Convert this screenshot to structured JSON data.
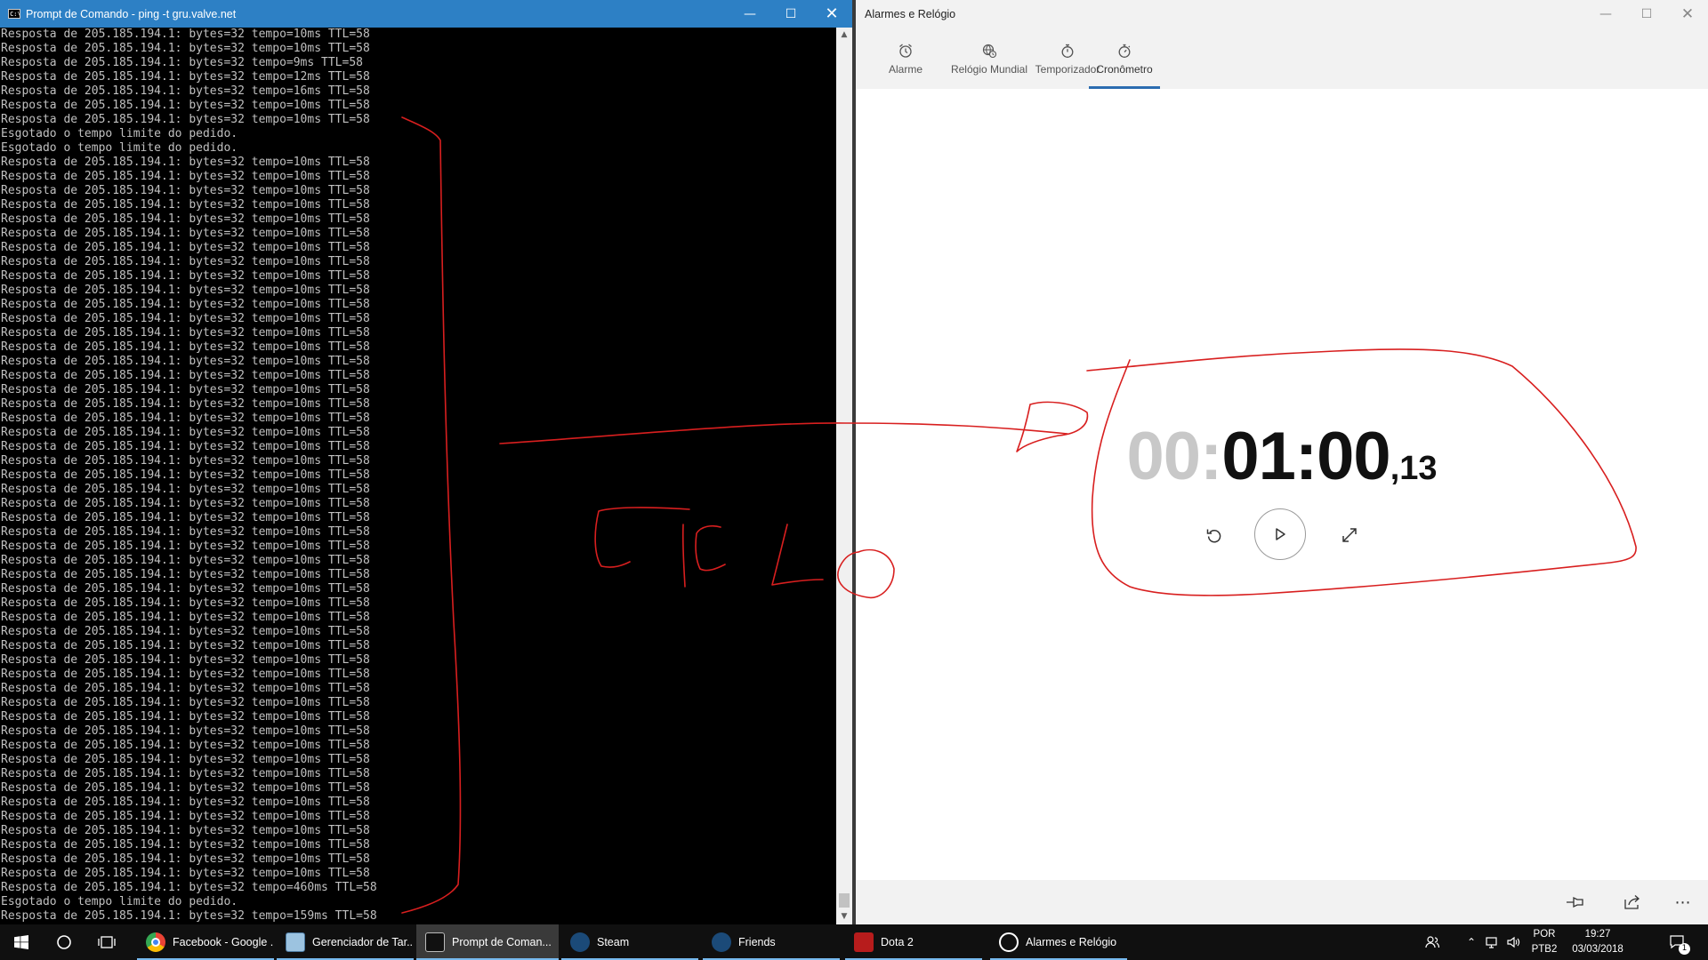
{
  "cmd": {
    "title": "Prompt de Comando - ping  -t gru.valve.net",
    "lines": [
      "Resposta de 205.185.194.1: bytes=32 tempo=10ms TTL=58",
      "Resposta de 205.185.194.1: bytes=32 tempo=10ms TTL=58",
      "Resposta de 205.185.194.1: bytes=32 tempo=9ms TTL=58",
      "Resposta de 205.185.194.1: bytes=32 tempo=12ms TTL=58",
      "Resposta de 205.185.194.1: bytes=32 tempo=16ms TTL=58",
      "Resposta de 205.185.194.1: bytes=32 tempo=10ms TTL=58",
      "Resposta de 205.185.194.1: bytes=32 tempo=10ms TTL=58",
      "Esgotado o tempo limite do pedido.",
      "Esgotado o tempo limite do pedido.",
      "Resposta de 205.185.194.1: bytes=32 tempo=10ms TTL=58",
      "Resposta de 205.185.194.1: bytes=32 tempo=10ms TTL=58",
      "Resposta de 205.185.194.1: bytes=32 tempo=10ms TTL=58",
      "Resposta de 205.185.194.1: bytes=32 tempo=10ms TTL=58",
      "Resposta de 205.185.194.1: bytes=32 tempo=10ms TTL=58",
      "Resposta de 205.185.194.1: bytes=32 tempo=10ms TTL=58",
      "Resposta de 205.185.194.1: bytes=32 tempo=10ms TTL=58",
      "Resposta de 205.185.194.1: bytes=32 tempo=10ms TTL=58",
      "Resposta de 205.185.194.1: bytes=32 tempo=10ms TTL=58",
      "Resposta de 205.185.194.1: bytes=32 tempo=10ms TTL=58",
      "Resposta de 205.185.194.1: bytes=32 tempo=10ms TTL=58",
      "Resposta de 205.185.194.1: bytes=32 tempo=10ms TTL=58",
      "Resposta de 205.185.194.1: bytes=32 tempo=10ms TTL=58",
      "Resposta de 205.185.194.1: bytes=32 tempo=10ms TTL=58",
      "Resposta de 205.185.194.1: bytes=32 tempo=10ms TTL=58",
      "Resposta de 205.185.194.1: bytes=32 tempo=10ms TTL=58",
      "Resposta de 205.185.194.1: bytes=32 tempo=10ms TTL=58",
      "Resposta de 205.185.194.1: bytes=32 tempo=10ms TTL=58",
      "Resposta de 205.185.194.1: bytes=32 tempo=10ms TTL=58",
      "Resposta de 205.185.194.1: bytes=32 tempo=10ms TTL=58",
      "Resposta de 205.185.194.1: bytes=32 tempo=10ms TTL=58",
      "Resposta de 205.185.194.1: bytes=32 tempo=10ms TTL=58",
      "Resposta de 205.185.194.1: bytes=32 tempo=10ms TTL=58",
      "Resposta de 205.185.194.1: bytes=32 tempo=10ms TTL=58",
      "Resposta de 205.185.194.1: bytes=32 tempo=10ms TTL=58",
      "Resposta de 205.185.194.1: bytes=32 tempo=10ms TTL=58",
      "Resposta de 205.185.194.1: bytes=32 tempo=10ms TTL=58",
      "Resposta de 205.185.194.1: bytes=32 tempo=10ms TTL=58",
      "Resposta de 205.185.194.1: bytes=32 tempo=10ms TTL=58",
      "Resposta de 205.185.194.1: bytes=32 tempo=10ms TTL=58",
      "Resposta de 205.185.194.1: bytes=32 tempo=10ms TTL=58",
      "Resposta de 205.185.194.1: bytes=32 tempo=10ms TTL=58",
      "Resposta de 205.185.194.1: bytes=32 tempo=10ms TTL=58",
      "Resposta de 205.185.194.1: bytes=32 tempo=10ms TTL=58",
      "Resposta de 205.185.194.1: bytes=32 tempo=10ms TTL=58",
      "Resposta de 205.185.194.1: bytes=32 tempo=10ms TTL=58",
      "Resposta de 205.185.194.1: bytes=32 tempo=10ms TTL=58",
      "Resposta de 205.185.194.1: bytes=32 tempo=10ms TTL=58",
      "Resposta de 205.185.194.1: bytes=32 tempo=10ms TTL=58",
      "Resposta de 205.185.194.1: bytes=32 tempo=10ms TTL=58",
      "Resposta de 205.185.194.1: bytes=32 tempo=10ms TTL=58",
      "Resposta de 205.185.194.1: bytes=32 tempo=10ms TTL=58",
      "Resposta de 205.185.194.1: bytes=32 tempo=10ms TTL=58",
      "Resposta de 205.185.194.1: bytes=32 tempo=10ms TTL=58",
      "Resposta de 205.185.194.1: bytes=32 tempo=10ms TTL=58",
      "Resposta de 205.185.194.1: bytes=32 tempo=10ms TTL=58",
      "Resposta de 205.185.194.1: bytes=32 tempo=10ms TTL=58",
      "Resposta de 205.185.194.1: bytes=32 tempo=10ms TTL=58",
      "Resposta de 205.185.194.1: bytes=32 tempo=10ms TTL=58",
      "Resposta de 205.185.194.1: bytes=32 tempo=10ms TTL=58",
      "Resposta de 205.185.194.1: bytes=32 tempo=10ms TTL=58",
      "Resposta de 205.185.194.1: bytes=32 tempo=460ms TTL=58",
      "Esgotado o tempo limite do pedido.",
      "Resposta de 205.185.194.1: bytes=32 tempo=159ms TTL=58"
    ]
  },
  "clock": {
    "title": "Alarmes e Relógio",
    "tabs": [
      {
        "label": "Alarme",
        "icon": "alarm-clock-icon"
      },
      {
        "label": "Relógio Mundial",
        "icon": "world-clock-icon"
      },
      {
        "label": "Temporizador",
        "icon": "timer-icon"
      },
      {
        "label": "Cronômetro",
        "icon": "stopwatch-icon"
      }
    ],
    "active_tab": "Cronômetro",
    "stopwatch": {
      "faded": "00:",
      "main": "01:00",
      "fraction": ",13"
    }
  },
  "taskbar": {
    "items": [
      {
        "label": "Facebook - Google ...",
        "color": "#e94235"
      },
      {
        "label": "Gerenciador de Tar...",
        "color": "#6fa0c8"
      },
      {
        "label": "Prompt de Coman...",
        "color": "#222222"
      },
      {
        "label": "Steam",
        "color": "#1b4a78"
      },
      {
        "label": "Friends",
        "color": "#1b4a78"
      },
      {
        "label": "Dota 2",
        "color": "#b71c1c"
      },
      {
        "label": "Alarmes e Relógio",
        "color": "#ffffff"
      }
    ],
    "tray": {
      "lang1": "POR",
      "lang2": "PTB2",
      "time": "19:27",
      "date": "03/03/2018",
      "notifications": "1"
    }
  },
  "colors": {
    "cmd_title": "#2d80c5",
    "accent": "#2b6cb0",
    "annotation": "#d81f1f"
  }
}
